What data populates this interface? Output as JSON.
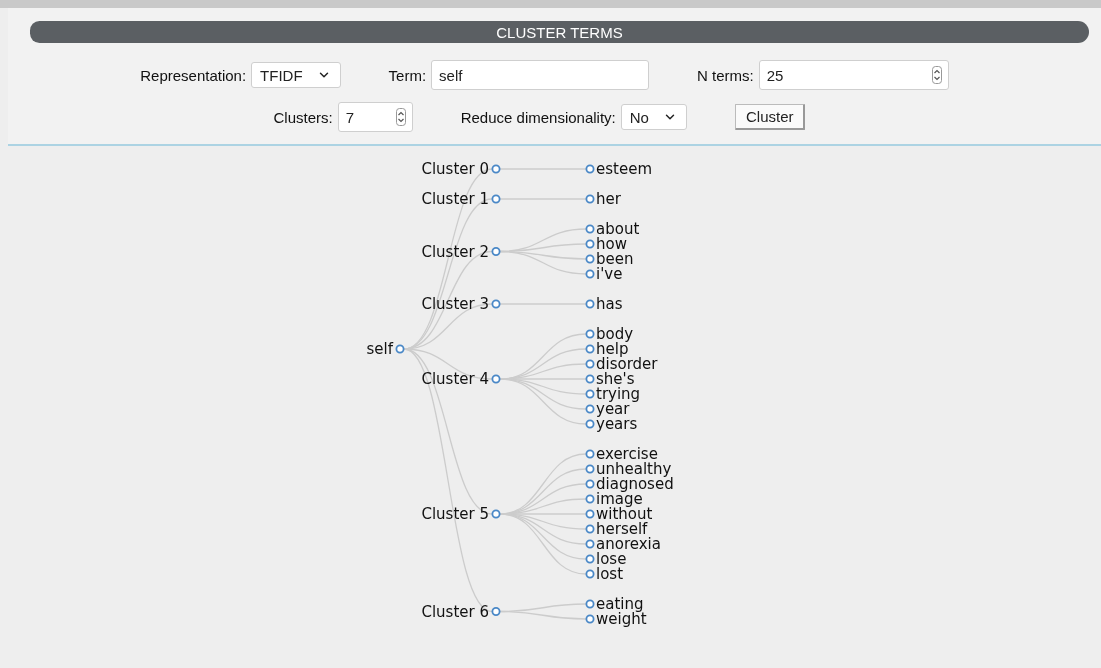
{
  "header": {
    "title": "CLUSTER TERMS"
  },
  "form": {
    "representation": {
      "label": "Representation:",
      "value": "TFIDF"
    },
    "term": {
      "label": "Term:",
      "value": "self"
    },
    "n_terms": {
      "label": "N terms:",
      "value": "25"
    },
    "clusters": {
      "label": "Clusters:",
      "value": "7"
    },
    "reduce_dimensionality": {
      "label": "Reduce dimensionality:",
      "value": "No"
    },
    "button": "Cluster"
  },
  "tree": {
    "label": "self",
    "children": [
      {
        "label": "Cluster 0",
        "children": [
          {
            "label": "esteem"
          }
        ]
      },
      {
        "label": "Cluster 1",
        "children": [
          {
            "label": "her"
          }
        ]
      },
      {
        "label": "Cluster 2",
        "children": [
          {
            "label": "about"
          },
          {
            "label": "how"
          },
          {
            "label": "been"
          },
          {
            "label": "i've"
          }
        ]
      },
      {
        "label": "Cluster 3",
        "children": [
          {
            "label": "has"
          }
        ]
      },
      {
        "label": "Cluster 4",
        "children": [
          {
            "label": "body"
          },
          {
            "label": "help"
          },
          {
            "label": "disorder"
          },
          {
            "label": "she's"
          },
          {
            "label": "trying"
          },
          {
            "label": "year"
          },
          {
            "label": "years"
          }
        ]
      },
      {
        "label": "Cluster 5",
        "children": [
          {
            "label": "exercise"
          },
          {
            "label": "unhealthy"
          },
          {
            "label": "diagnosed"
          },
          {
            "label": "image"
          },
          {
            "label": "without"
          },
          {
            "label": "herself"
          },
          {
            "label": "anorexia"
          },
          {
            "label": "lose"
          },
          {
            "label": "lost"
          }
        ]
      },
      {
        "label": "Cluster 6",
        "children": [
          {
            "label": "eating"
          },
          {
            "label": "weight"
          }
        ]
      }
    ]
  }
}
